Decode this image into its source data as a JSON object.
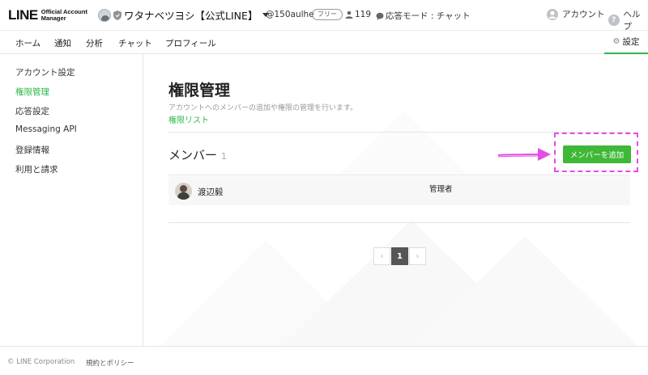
{
  "header": {
    "logo_main": "LINE",
    "logo_sub": "Official Account Manager",
    "account_name": "ワタナベツヨシ【公式LINE】",
    "account_id": "@150aulhe",
    "plan_badge": "フリー",
    "friend_count": "119",
    "response_mode": "応答モード : チャット",
    "account_link": "アカウント",
    "help_link": "ヘルプ"
  },
  "nav": {
    "items": [
      {
        "label": "ホーム"
      },
      {
        "label": "通知"
      },
      {
        "label": "分析"
      },
      {
        "label": "チャット"
      },
      {
        "label": "プロフィール"
      }
    ],
    "settings_label": "設定"
  },
  "sidebar": {
    "items": [
      {
        "label": "アカウント設定",
        "active": false
      },
      {
        "label": "権限管理",
        "active": true
      },
      {
        "label": "応答設定",
        "active": false
      },
      {
        "label": "Messaging API",
        "active": false
      },
      {
        "label": "登録情報",
        "active": false
      },
      {
        "label": "利用と請求",
        "active": false
      }
    ]
  },
  "main": {
    "title": "権限管理",
    "description": "アカウントへのメンバーの追加や権限の管理を行います。",
    "permission_link": "権限リスト",
    "members_title": "メンバー",
    "members_count": "1",
    "add_member_label": "メンバーを追加",
    "members": [
      {
        "name": "渡辺毅",
        "role": "管理者"
      }
    ]
  },
  "pagination": {
    "prev": "‹",
    "current": "1",
    "next": "›"
  },
  "footer": {
    "copyright": "© LINE Corporation",
    "policy": "規約とポリシー"
  },
  "colors": {
    "accent": "#2cb84b",
    "button": "#3fb837",
    "highlight": "#e64ce6"
  }
}
